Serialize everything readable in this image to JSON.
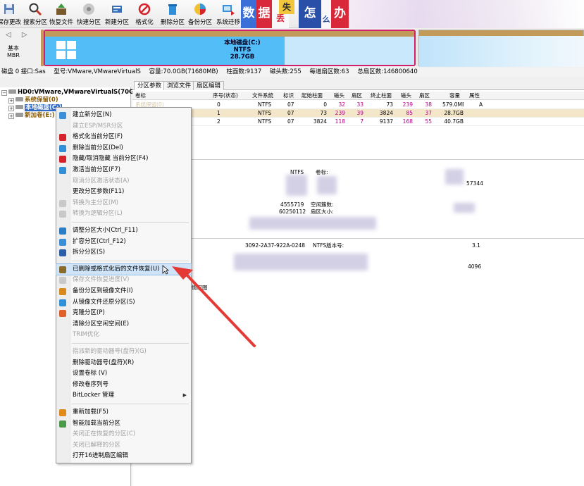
{
  "toolbar": {
    "buttons": [
      {
        "label": "保存更改",
        "icon": "save-icon"
      },
      {
        "label": "搜索分区",
        "icon": "search-icon"
      },
      {
        "label": "恢复文件",
        "icon": "recover-file-icon"
      },
      {
        "label": "快速分区",
        "icon": "quick-partition-icon"
      },
      {
        "label": "新建分区",
        "icon": "new-partition-icon"
      },
      {
        "label": "格式化",
        "icon": "format-icon"
      },
      {
        "label": "删除分区",
        "icon": "delete-icon"
      },
      {
        "label": "备份分区",
        "icon": "backup-icon"
      },
      {
        "label": "系统迁移",
        "icon": "migrate-icon"
      }
    ],
    "banner": [
      "数",
      "据",
      "丢",
      "失",
      "怎",
      "么",
      "办"
    ]
  },
  "disk_nav": {
    "arrows": "◁ ▷",
    "label_1": "基本",
    "label_2": "MBR"
  },
  "partition_bar": {
    "name": "本地磁盘(C:)",
    "fs": "NTFS",
    "size": "28.7GB"
  },
  "infoline": {
    "disk": "磁盘 0 接口:Sas",
    "model": "型号:VMware,VMwareVirtualS",
    "capacity": "容量:70.0GB(71680MB)",
    "cylinders": "柱面数:9137",
    "heads": "磁头数:255",
    "sectors_per_track": "每道扇区数:63",
    "total_sectors": "总扇区数:146800640"
  },
  "tree": {
    "root": "HD0:VMware,VMwareVirtualS(70GB)",
    "items": [
      "系统保留(0)",
      "本地磁盘(C:)",
      "新加卷(E:)"
    ]
  },
  "tabs": [
    "分区参数",
    "浏览文件",
    "扇区编辑"
  ],
  "table": {
    "headers": [
      "卷标",
      "序号(状态)",
      "文件系统",
      "标识",
      "起始柱面",
      "磁头",
      "扇区",
      "终止柱面",
      "磁头",
      "扇区",
      "容量",
      "属性"
    ],
    "rows": [
      {
        "label": "系统保留(0)",
        "idx": "0",
        "fs": "NTFS",
        "id": "07",
        "sc": "0",
        "sh": "32",
        "ss": "33",
        "ec": "73",
        "eh": "239",
        "es": "38",
        "cap": "579.0MB",
        "attr": "A"
      },
      {
        "label": "本地磁盘(C:)",
        "idx": "1",
        "fs": "NTFS",
        "id": "07",
        "sc": "73",
        "sh": "239",
        "ss": "39",
        "ec": "3824",
        "eh": "85",
        "es": "37",
        "cap": "28.7GB",
        "attr": ""
      },
      {
        "label": "新加卷(E:)",
        "idx": "2",
        "fs": "NTFS",
        "id": "07",
        "sc": "3824",
        "sh": "118",
        "ss": "7",
        "ec": "9137",
        "eh": "168",
        "es": "55",
        "cap": "40.7GB",
        "attr": ""
      }
    ]
  },
  "details": {
    "fs_value": "NTFS",
    "label_key": "卷标:",
    "v1": "57344",
    "v2": "4555719",
    "free_clusters_key": "空闲簇数:",
    "v3": "60250112",
    "sector_size_key": "扇区大小:",
    "serial": "3092-2A37-922A-0248",
    "ntfs_version_key": "NTFS版本号:",
    "ntfs_version": "3.1",
    "v4": "4096",
    "trunc": "情况图"
  },
  "context_menu": {
    "items": [
      {
        "label": "建立新分区(N)",
        "enabled": true,
        "icon": "new-partition-icon",
        "color": "#3a8fd8"
      },
      {
        "label": "建立ESP/MSR分区",
        "enabled": false,
        "icon": "",
        "color": ""
      },
      {
        "label": "格式化当前分区(F)",
        "enabled": true,
        "icon": "format-icon",
        "color": "#d6232b"
      },
      {
        "label": "删除当前分区(Del)",
        "enabled": true,
        "icon": "delete-icon",
        "color": "#2f8fd8"
      },
      {
        "label": "隐藏/取消隐藏 当前分区(F4)",
        "enabled": true,
        "icon": "hide-icon",
        "color": "#d6232b"
      },
      {
        "label": "激活当前分区(F7)",
        "enabled": true,
        "icon": "activate-icon",
        "color": "#2f8fd8"
      },
      {
        "label": "取消分区激活状态(A)",
        "enabled": false,
        "icon": "",
        "color": ""
      },
      {
        "label": "更改分区参数(F11)",
        "enabled": true,
        "icon": "",
        "color": ""
      },
      {
        "label": "转换为主分区(M)",
        "enabled": false,
        "icon": "convert-primary-icon",
        "color": "#c9c9c9"
      },
      {
        "label": "转换为逻辑分区(L)",
        "enabled": false,
        "icon": "convert-logical-icon",
        "color": "#c9c9c9"
      },
      {
        "label": "调整分区大小(Ctrl_F11)",
        "enabled": true,
        "icon": "resize-icon",
        "color": "#2b7ec4"
      },
      {
        "label": "扩容分区(Ctrl_F12)",
        "enabled": true,
        "icon": "extend-icon",
        "color": "#3a8fd8"
      },
      {
        "label": "拆分分区(S)",
        "enabled": true,
        "icon": "split-icon",
        "color": "#2b5fa8"
      },
      {
        "label": "已删除或格式化后的文件恢复(U)",
        "enabled": true,
        "icon": "recover-file-icon",
        "color": "#8a6a2a"
      },
      {
        "label": "保存文件恢复进度(V)",
        "enabled": false,
        "icon": "save-progress-icon",
        "color": "#c9c9c9"
      },
      {
        "label": "备份分区到镜像文件(I)",
        "enabled": true,
        "icon": "backup-icon",
        "color": "#d98a1a"
      },
      {
        "label": "从镜像文件还原分区(S)",
        "enabled": true,
        "icon": "restore-icon",
        "color": "#2f8fd8"
      },
      {
        "label": "克隆分区(P)",
        "enabled": true,
        "icon": "clone-icon",
        "color": "#e0602a"
      },
      {
        "label": "清除分区空闲空间(E)",
        "enabled": true,
        "icon": "",
        "color": ""
      },
      {
        "label": "TRIM优化",
        "enabled": false,
        "icon": "",
        "color": ""
      },
      {
        "label": "指派新的驱动器号(盘符)(G)",
        "enabled": false,
        "icon": "",
        "color": ""
      },
      {
        "label": "删除驱动器号(盘符)(R)",
        "enabled": true,
        "icon": "",
        "color": ""
      },
      {
        "label": "设置卷标 (V)",
        "enabled": true,
        "icon": "",
        "color": ""
      },
      {
        "label": "修改卷序列号",
        "enabled": true,
        "icon": "",
        "color": ""
      },
      {
        "label": "BitLocker 管理",
        "enabled": true,
        "icon": "",
        "color": "",
        "submenu": "▶"
      },
      {
        "label": "重新加载(F5)",
        "enabled": true,
        "icon": "reload-icon",
        "color": "#e08a1a"
      },
      {
        "label": "智能加载当前分区",
        "enabled": true,
        "icon": "smart-load-icon",
        "color": "#4a9a4a"
      },
      {
        "label": "关闭正在恢复的分区(C)",
        "enabled": false,
        "icon": "",
        "color": ""
      },
      {
        "label": "关闭已解释的分区",
        "enabled": false,
        "icon": "",
        "color": ""
      },
      {
        "label": "打开16进制扇区编辑",
        "enabled": true,
        "icon": "",
        "color": ""
      }
    ]
  },
  "colors": {
    "accent": "#e03838",
    "selection": "#316ac5",
    "hover": "#cfe4f8"
  }
}
